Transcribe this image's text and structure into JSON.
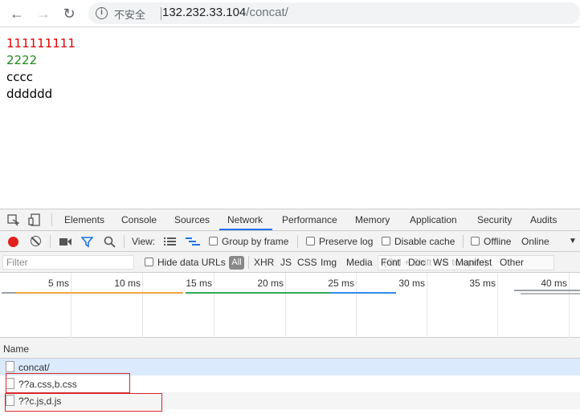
{
  "browser": {
    "insecure_label": "不安全",
    "url_host": "132.232.33.104",
    "url_path": "/concat/"
  },
  "page": {
    "lines": [
      "111111111",
      "2222",
      "cccc",
      "dddddd"
    ],
    "colors": {
      "line1": "#e60000",
      "line2": "#1e8a1e"
    }
  },
  "devtools": {
    "tabs": [
      "Elements",
      "Console",
      "Sources",
      "Network",
      "Performance",
      "Memory",
      "Application",
      "Security",
      "Audits"
    ],
    "active_tab": "Network",
    "toolbar": {
      "view_label": "View:",
      "group_by_frame": "Group by frame",
      "preserve_log": "Preserve log",
      "disable_cache": "Disable cache",
      "offline": "Offline",
      "throttle": "Online"
    },
    "filter": {
      "placeholder": "Filter",
      "hide_data_urls": "Hide data URLs",
      "types": [
        "All",
        "XHR",
        "JS",
        "CSS",
        "Img",
        "Media",
        "Font",
        "Doc",
        "WS",
        "Manifest",
        "Other"
      ],
      "overlay_hint": "(Ctrl + Shift + E to open)"
    },
    "timeline": {
      "ticks": [
        "5 ms",
        "10 ms",
        "15 ms",
        "20 ms",
        "25 ms",
        "30 ms",
        "35 ms",
        "40 ms"
      ]
    },
    "requests": {
      "column_name": "Name",
      "rows": [
        "concat/",
        "??a.css,b.css",
        "??c.js,d.js"
      ]
    }
  }
}
